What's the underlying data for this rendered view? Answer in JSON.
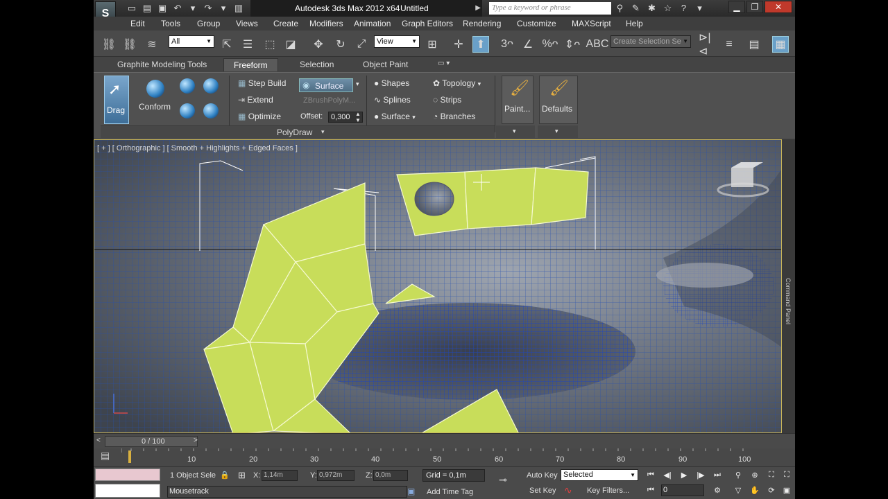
{
  "app": {
    "name": "Autodesk 3ds Max  2012 x64",
    "document": "Untitled",
    "search_placeholder": "Type a keyword or phrase"
  },
  "menu": [
    "Edit",
    "Tools",
    "Group",
    "Views",
    "Create",
    "Modifiers",
    "Animation",
    "Graph Editors",
    "Rendering",
    "Customize",
    "MAXScript",
    "Help"
  ],
  "toolbar": {
    "selection_filter": "All",
    "ref_coord": "View",
    "named_selection_placeholder": "Create Selection Se"
  },
  "ribbon": {
    "tabs": [
      "Graphite Modeling Tools",
      "Freeform",
      "Selection",
      "Object Paint"
    ],
    "active_tab": "Freeform",
    "drag_label": "Drag",
    "conform_label": "Conform",
    "step_build": "Step Build",
    "extend": "Extend",
    "optimize": "Optimize",
    "surface_button": "Surface",
    "zbrush": "ZBrushPolyM...",
    "offset_label": "Offset:",
    "offset_value": "0,300",
    "shapes": "Shapes",
    "splines": "Splines",
    "surface2": "Surface",
    "topology": "Topology",
    "strips": "Strips",
    "branches": "Branches",
    "paint": "Paint...",
    "defaults": "Defaults",
    "panel_name": "PolyDraw"
  },
  "viewport": {
    "label": "[ + ] [ Orthographic ] [ Smooth + Highlights + Edged Faces ]",
    "command_panel": "Command Panel"
  },
  "timeline": {
    "slider": "0 / 100",
    "ticks": [
      "10",
      "20",
      "30",
      "40",
      "50",
      "60",
      "70",
      "80",
      "90",
      "100"
    ]
  },
  "status": {
    "selection": "1 Object Sele",
    "x_label": "X:",
    "x_value": "1,14m",
    "y_label": "Y:",
    "y_value": "0,972m",
    "z_label": "Z:",
    "z_value": "0,0m",
    "grid": "Grid = 0,1m",
    "auto_key": "Auto Key",
    "key_mode": "Selected",
    "set_key": "Set Key",
    "key_filters": "Key Filters...",
    "frame": "0",
    "mousetrack": "Mousetrack",
    "add_time_tag": "Add Time Tag"
  },
  "colors": {
    "patch": "#c7dd5a",
    "wire": "#1f4ea8",
    "viewport_border": "#c8b45a"
  }
}
